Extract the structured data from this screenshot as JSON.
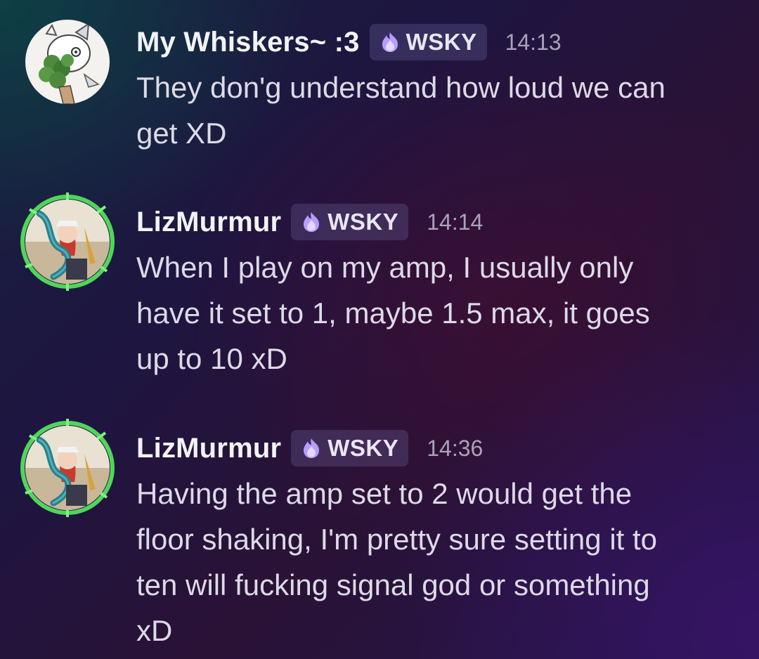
{
  "messages": [
    {
      "username": "My Whiskers~ :3",
      "tag": "WSKY",
      "time": "14:13",
      "lines": [
        "They don'g understand how loud we can",
        "get XD"
      ]
    },
    {
      "username": "LizMurmur",
      "tag": "WSKY",
      "time": "14:14",
      "lines": [
        "When I play on my amp, I usually only",
        "have it set to 1, maybe 1.5 max,  it goes",
        "up to 10 xD"
      ]
    },
    {
      "username": "LizMurmur",
      "tag": "WSKY",
      "time": "14:36",
      "lines": [
        "Having the amp set to 2 would get the",
        "floor shaking, I'm pretty sure setting it to",
        "ten will fucking signal god or something",
        "xD"
      ]
    }
  ],
  "colors": {
    "username": "#f2f3f5",
    "message_text": "#dcdae6",
    "timestamp": "#a7a3b8",
    "tag_background": "#4b4270",
    "tag_icon": "#b89cff",
    "avatar_ring": "#4fd65a"
  }
}
